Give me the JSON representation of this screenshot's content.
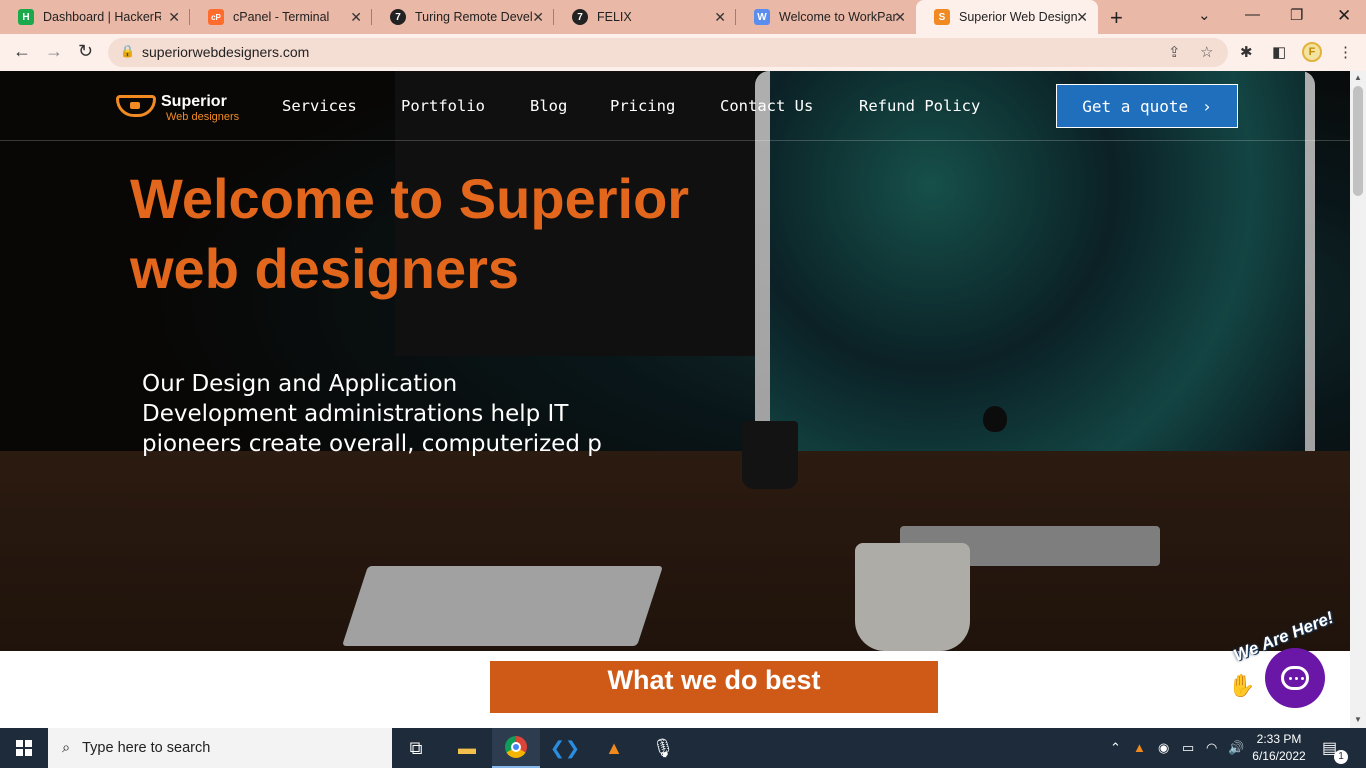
{
  "browser": {
    "tabs": [
      {
        "title": "Dashboard | HackerRa",
        "icon": "hackerrank-icon",
        "color": "#1ba94c",
        "glyph": "H"
      },
      {
        "title": "cPanel - Terminal",
        "icon": "cpanel-icon",
        "color": "#ff6c2c",
        "glyph": "cP"
      },
      {
        "title": "Turing Remote Develo",
        "icon": "turing-icon",
        "color": "#222222",
        "glyph": "7"
      },
      {
        "title": "FELIX",
        "icon": "turing-icon",
        "color": "#222222",
        "glyph": "7"
      },
      {
        "title": "Welcome to WorkPar",
        "icon": "workpar-icon",
        "color": "#5b8def",
        "glyph": "W"
      },
      {
        "title": "Superior Web Designe",
        "icon": "superior-icon",
        "color": "#f28a23",
        "glyph": "S",
        "active": true
      }
    ],
    "new_tab": "+",
    "url": "superiorwebdesigners.com",
    "profile_initial": "F"
  },
  "site": {
    "logo": {
      "name": "Superior",
      "sub": "Web designers"
    },
    "nav": [
      "Services",
      "Portfolio",
      "Blog",
      "Pricing",
      "Contact Us",
      "Refund Policy"
    ],
    "cta": "Get a quote",
    "cta_color": "#1f6fbd",
    "hero_title": "Welcome to Superior web designers",
    "hero_title_color": "#e3661d",
    "hero_sub": "Our Design and Application Development administrations help IT pioneers create overall, computerized p",
    "section_title": "What we do best",
    "section_color": "#cf5a17",
    "chat_badge": "We Are Here!",
    "chat_color": "#6a16a6"
  },
  "taskbar": {
    "search_placeholder": "Type here to search",
    "time": "2:33 PM",
    "date": "6/16/2022",
    "notifications": "1"
  }
}
